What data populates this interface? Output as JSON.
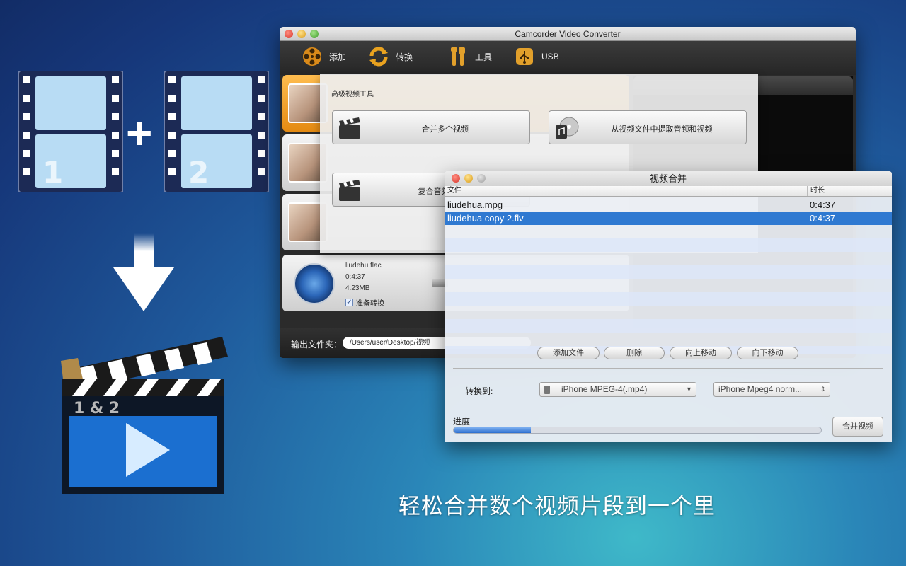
{
  "main_window": {
    "title": "Camcorder Video Converter",
    "toolbar": {
      "add_label": "添加",
      "convert_label": "转换",
      "tools_label": "工具",
      "usb_label": "USB"
    },
    "file4": {
      "name": "liudehu.flac",
      "duration": "0:4:37",
      "size": "4.23MB",
      "ready_label": "准备转换"
    },
    "output_label": "输出文件夹：",
    "output_path": "/Users/user/Desktop/视频"
  },
  "tools_panel": {
    "title": "高级视频工具",
    "merge_label": "合并多个视频",
    "extract_label": "从视频文件中提取音频和视频",
    "mux_label": "复合音频和视频"
  },
  "merge_dialog": {
    "title": "视频合并",
    "col_file": "文件",
    "col_duration": "时长",
    "files": [
      {
        "name": "liudehua.mpg",
        "duration": "0:4:37",
        "selected": false
      },
      {
        "name": "liudehua copy 2.flv",
        "duration": "0:4:37",
        "selected": true
      }
    ],
    "buttons": {
      "add": "添加文件",
      "delete": "删除",
      "up": "向上移动",
      "down": "向下移动"
    },
    "convert_to_label": "转换到:",
    "format_value": "iPhone MPEG-4(.mp4)",
    "quality_value": "iPhone Mpeg4 norm...",
    "progress_label": "进度",
    "progress": 0.21,
    "merge_button": "合并视频"
  },
  "slogan": "轻松合并数个视频片段到一个里",
  "colors": {
    "selection": "#2f79d1",
    "accent_orange": "#e48a12"
  }
}
